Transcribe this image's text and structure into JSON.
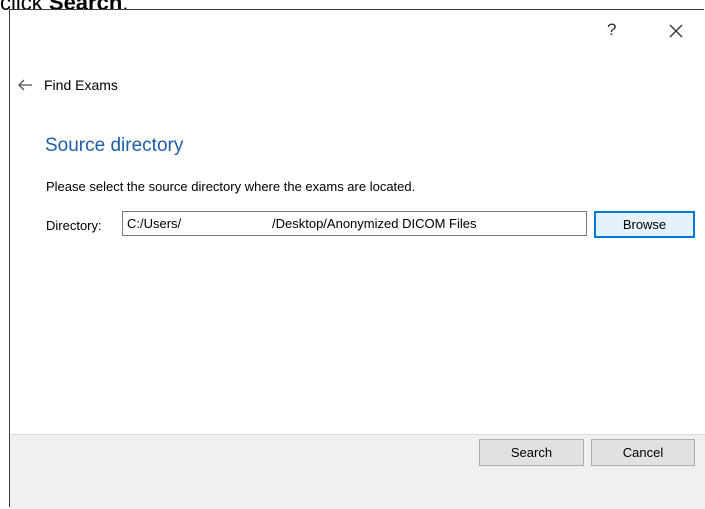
{
  "caption": {
    "prefix": "click ",
    "bold": "Search",
    "suffix": "."
  },
  "titlebar": {
    "help_label": "?",
    "close_icon": "close-icon"
  },
  "nav": {
    "back_icon": "back-arrow-icon",
    "title": "Find Exams"
  },
  "section": {
    "title": "Source directory",
    "instructions": "Please select the source directory where the exams are located."
  },
  "directory": {
    "label": "Directory:",
    "value_part1": "C:/Users/",
    "value_part2": "/Desktop/Anonymized DICOM Files",
    "browse_label": "Browse"
  },
  "footer": {
    "search_label": "Search",
    "cancel_label": "Cancel"
  },
  "colors": {
    "section_title": "#1f5da8",
    "browse_focus_border": "#0078d7",
    "footer_bg": "#f0f0f0"
  }
}
